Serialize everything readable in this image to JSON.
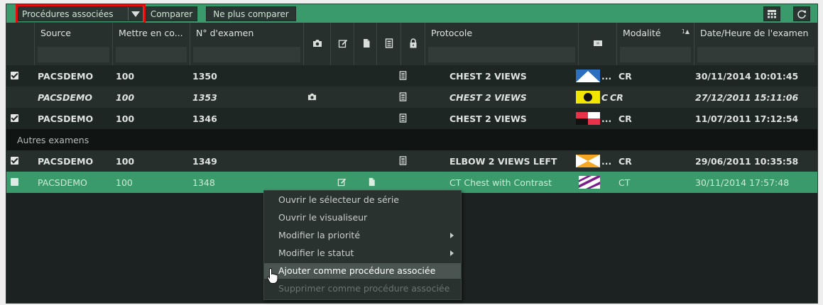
{
  "toolbar": {
    "dropdown_label": "Procédures associées",
    "compare_label": "Comparer",
    "no_compare_label": "Ne plus comparer",
    "layout_icon": "grid-layout-icon",
    "refresh_icon": "refresh-icon"
  },
  "columns": {
    "source": "Source",
    "priority": "Mettre en co...",
    "exam_number": "N° d'examen",
    "protocol": "Protocole",
    "modality": "Modalité",
    "modality_sort": "1▲",
    "datetime": "Date/Heure de l'examen"
  },
  "rows": [
    {
      "checked": true,
      "source": "PACSDEMO",
      "priority": "100",
      "exam": "1350",
      "protocol": "CHEST 2 VIEWS",
      "ellipsis": "...",
      "modality": "CR",
      "datetime": "30/11/2014 10:01:45"
    },
    {
      "checked": false,
      "source": "PACSDEMO",
      "priority": "100",
      "exam": "1353",
      "protocol": "CHEST 2 VIEWS",
      "ellipsis": "C",
      "modality": "CR",
      "datetime": "27/12/2011 15:11:06"
    },
    {
      "checked": true,
      "source": "PACSDEMO",
      "priority": "100",
      "exam": "1346",
      "protocol": "CHEST 2 VIEWS",
      "ellipsis": "...",
      "modality": "CR",
      "datetime": "11/07/2011 17:12:54"
    },
    {
      "checked": true,
      "source": "PACSDEMO",
      "priority": "100",
      "exam": "1349",
      "protocol": "ELBOW 2 VIEWS LEFT",
      "ellipsis": "...",
      "modality": "CR",
      "datetime": "29/06/2011 10:35:58"
    },
    {
      "checked": false,
      "source": "PACSDEMO",
      "priority": "100",
      "exam": "1348",
      "protocol": "CT Chest with Contrast",
      "ellipsis": "",
      "modality": "CT",
      "datetime": "30/11/2014 17:57:48"
    }
  ],
  "group_label": "Autres examens",
  "context_menu": [
    {
      "label": "Ouvrir le sélecteur de série"
    },
    {
      "label": "Ouvrir le visualiseur"
    },
    {
      "label": "Modifier la priorité"
    },
    {
      "label": "Modifier le statut"
    },
    {
      "label": "Ajouter comme procédure associée"
    },
    {
      "label": "Supprimer comme procédure associée"
    }
  ],
  "colors": {
    "accent": "#3a9a6b",
    "highlight": "#e01010",
    "background": "#1c2221"
  }
}
